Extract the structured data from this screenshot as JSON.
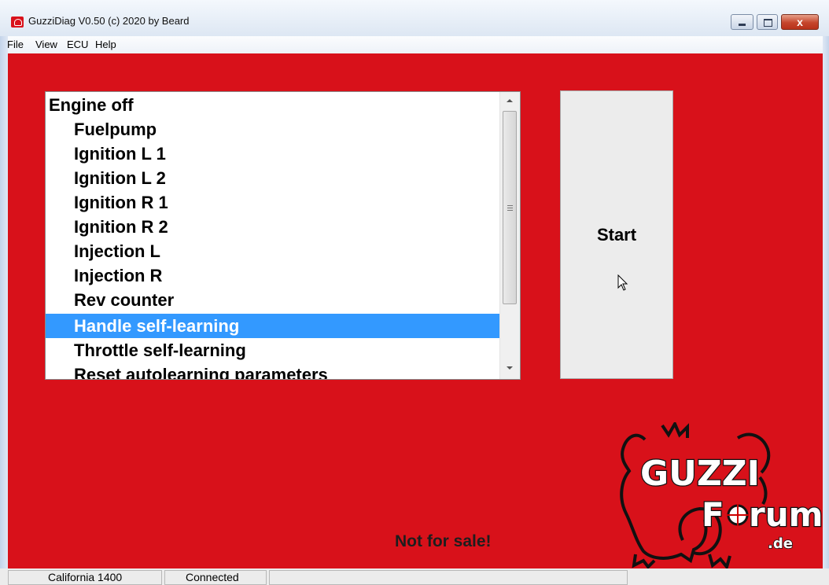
{
  "window": {
    "title": "GuzziDiag V0.50  (c) 2020 by Beard",
    "close_glyph": "x"
  },
  "menu": {
    "items": [
      "File",
      "View",
      "ECU",
      "Help"
    ]
  },
  "list": {
    "items": [
      {
        "label": "Engine off"
      },
      {
        "label": "Fuelpump"
      },
      {
        "label": "Ignition L 1"
      },
      {
        "label": "Ignition L 2"
      },
      {
        "label": "Ignition R 1"
      },
      {
        "label": "Ignition R 2"
      },
      {
        "label": "Injection L"
      },
      {
        "label": "Injection R"
      },
      {
        "label": "Rev counter"
      },
      {
        "label": "Handle self-learning"
      },
      {
        "label": "Throttle self-learning"
      },
      {
        "label": "Reset autolearning parameters"
      }
    ],
    "selected_index": 9
  },
  "start_button": {
    "label": "Start"
  },
  "note": "Not for sale!",
  "logo": {
    "line1": "GUZZI",
    "line2_left": "F",
    "line2_right": "rum",
    "suffix": ".de"
  },
  "status": {
    "model": "California 1400",
    "connection": "Connected"
  },
  "colors": {
    "background": "#d8111a",
    "selection": "#3399ff"
  }
}
